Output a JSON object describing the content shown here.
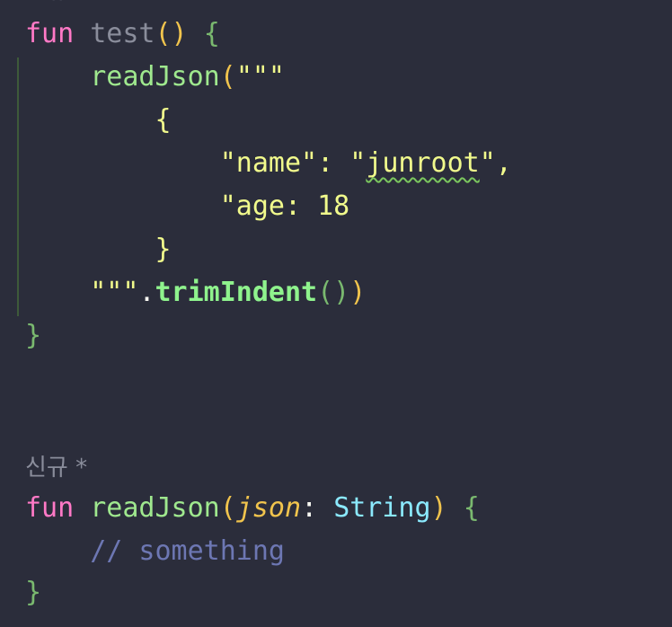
{
  "code": {
    "partial_hint": "신규",
    "test_fn": {
      "keyword": "fun",
      "name": "test",
      "parens": "()",
      "open_brace": "{",
      "call_name": "readJson",
      "call_open": "(",
      "triple_quote_open": "\"\"\"",
      "json_open": "{",
      "name_key": "\"name\"",
      "colon_space": ": ",
      "quote": "\"",
      "name_value": "junroot",
      "name_value_close": "\",",
      "age_line": "\"age: 18",
      "json_close": "}",
      "triple_quote_close": "\"\"\"",
      "dot": ".",
      "trim_fn": "trimIndent",
      "trim_parens": "()",
      "call_close": ")",
      "close_brace": "}"
    },
    "hint": {
      "label": "신규 *"
    },
    "read_fn": {
      "keyword": "fun",
      "name": "readJson",
      "open_paren": "(",
      "param_name": "json",
      "colon": ": ",
      "param_type": "String",
      "close_paren": ")",
      "open_brace": "{",
      "comment": "// something",
      "close_brace": "}"
    }
  }
}
